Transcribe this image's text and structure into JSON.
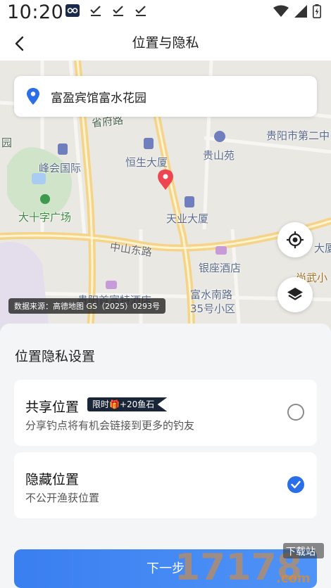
{
  "status_bar": {
    "time": "10:20"
  },
  "nav": {
    "title": "位置与隐私"
  },
  "map": {
    "search_text": "富盈宾馆富水花园",
    "labels": {
      "fuchu_road": "省府路",
      "guiyang_second": "贵阳市第二中",
      "fenghui": "峰会国际",
      "hengsheng": "恒生大厦",
      "guishanyuan": "贵山苑",
      "shizi": "大十字广场",
      "tianye": "天业大厦",
      "zhongshan": "中山东路",
      "yinzuo": "银座酒店",
      "fushui_south": "富水南路",
      "no35": "35号小区",
      "hotel_partial": "贵阳首富特酒店",
      "left_partial": "园",
      "right_partial": "大厦",
      "right_partial2": "尚武小"
    },
    "attribution": "数据来源：高德地图 GS（2025）0293号"
  },
  "sheet": {
    "title": "位置隐私设置",
    "options": [
      {
        "title": "共享位置",
        "badge": "限时🎁+20鱼石",
        "desc": "分享钓点将有机会链接到更多的钓友",
        "selected": false
      },
      {
        "title": "隐藏位置",
        "desc": "不公开渔获位置",
        "selected": true
      }
    ],
    "next_label": "下一步"
  },
  "watermark": {
    "text": "17178",
    "domain": ".com",
    "tag": "下载站"
  },
  "colors": {
    "accent": "#2b6fe8",
    "pin": "#ee4650",
    "badge_bg": "#1a2538"
  }
}
